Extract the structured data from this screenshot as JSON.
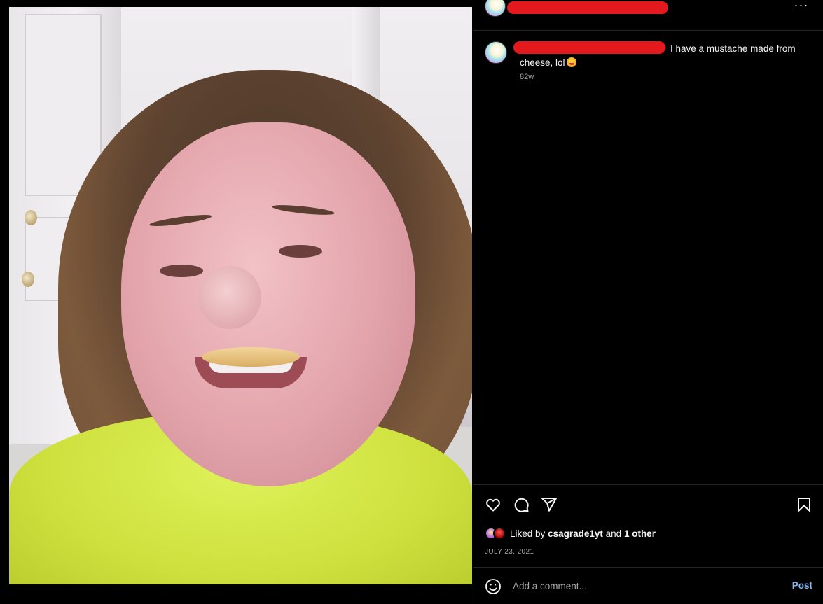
{
  "post": {
    "caption_text": "I have a mustache made from cheese, lol",
    "caption_emoji": "smiling-face-with-tongue-emoji",
    "timestamp_relative": "82w"
  },
  "header": {
    "more_label": "···"
  },
  "likes": {
    "prefix": "Liked by",
    "user": "csagrade1yt",
    "joiner": "and",
    "others": "1 other"
  },
  "date": "JULY 23, 2021",
  "comment": {
    "placeholder": "Add a comment...",
    "post_label": "Post"
  },
  "colors": {
    "background": "#000000",
    "redaction": "#e3191d",
    "post_button": "#84b7f2",
    "divider": "#262626"
  },
  "icons": [
    "heart-icon",
    "comment-icon",
    "share-icon",
    "bookmark-icon",
    "emoji-icon",
    "more-options-icon"
  ]
}
